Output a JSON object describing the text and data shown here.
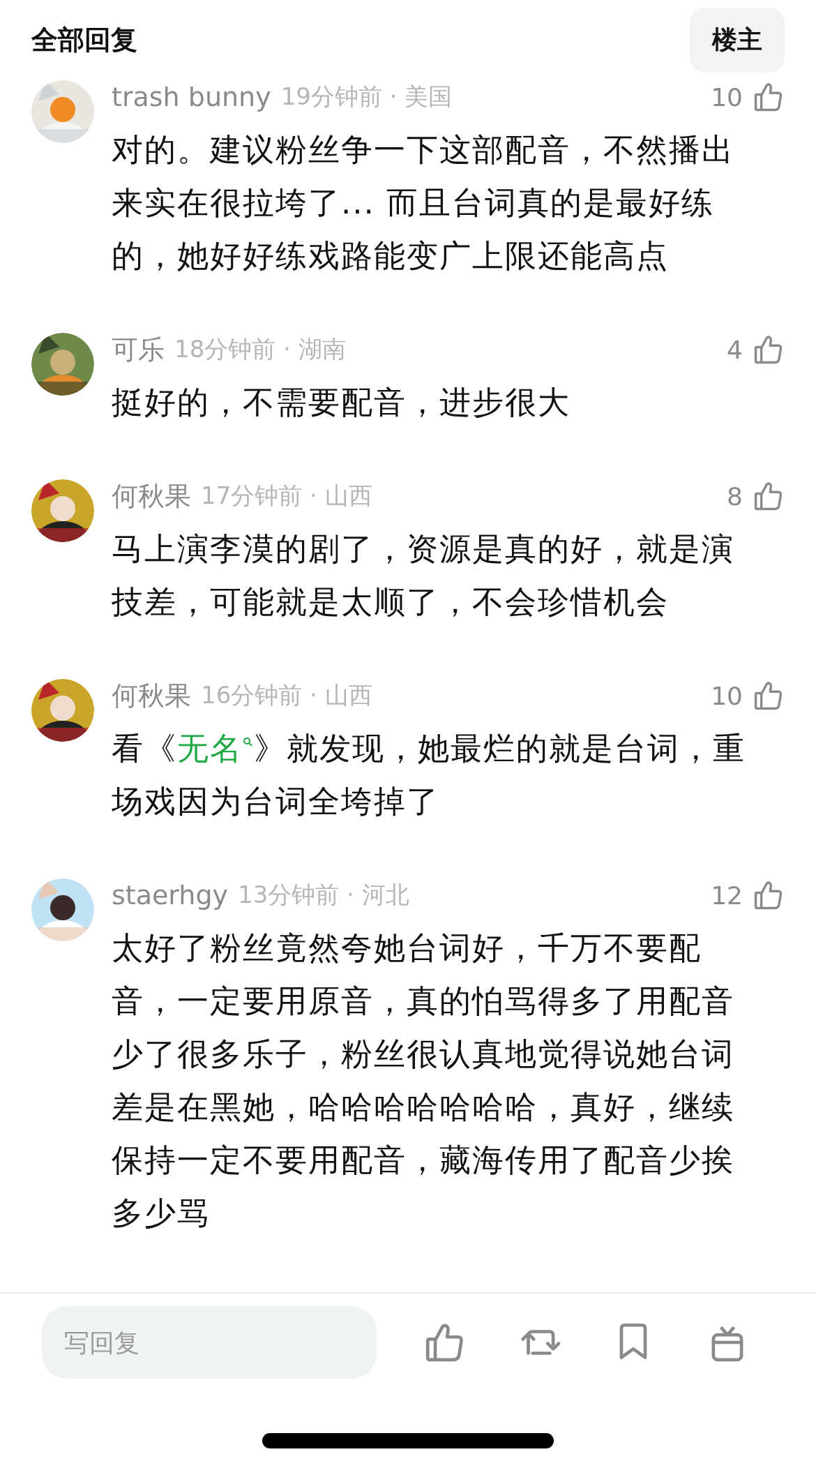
{
  "header": {
    "title": "全部回复",
    "op_button": "楼主"
  },
  "comments": [
    {
      "name": "trash bunny",
      "meta": "19分钟前 · 美国",
      "likes": "10",
      "body": [
        {
          "kind": "text",
          "text": "对的。建议粉丝争一下这部配音，不然播出来实在很拉垮了... 而且台词真的是最好练的，她好好练戏路能变广上限还能高点"
        }
      ]
    },
    {
      "name": "可乐",
      "meta": "18分钟前 · 湖南",
      "likes": "4",
      "body": [
        {
          "kind": "text",
          "text": "挺好的，不需要配音，进步很大"
        }
      ]
    },
    {
      "name": "何秋果",
      "meta": "17分钟前 · 山西",
      "likes": "8",
      "body": [
        {
          "kind": "text",
          "text": "马上演李漠的剧了，资源是真的好，就是演技差，可能就是太顺了，不会珍惜机会"
        }
      ]
    },
    {
      "name": "何秋果",
      "meta": "16分钟前 · 山西",
      "likes": "10",
      "body": [
        {
          "kind": "text",
          "text": "看《"
        },
        {
          "kind": "link",
          "text": "无名"
        },
        {
          "kind": "text",
          "text": "》就发现，她最烂的就是台词，重场戏因为台词全垮掉了"
        }
      ]
    },
    {
      "name": "staerhgy",
      "meta": "13分钟前 · 河北",
      "likes": "12",
      "body": [
        {
          "kind": "text",
          "text": "太好了粉丝竟然夸她台词好，千万不要配音，一定要用原音，真的怕骂得多了用配音少了很多乐子，粉丝很认真地觉得说她台词差是在黑她，哈哈哈哈哈哈哈，真好，继续保持一定不要用配音，藏海传用了配音少挨多少骂"
        }
      ]
    }
  ],
  "reply_field": {
    "placeholder": "写回复"
  }
}
